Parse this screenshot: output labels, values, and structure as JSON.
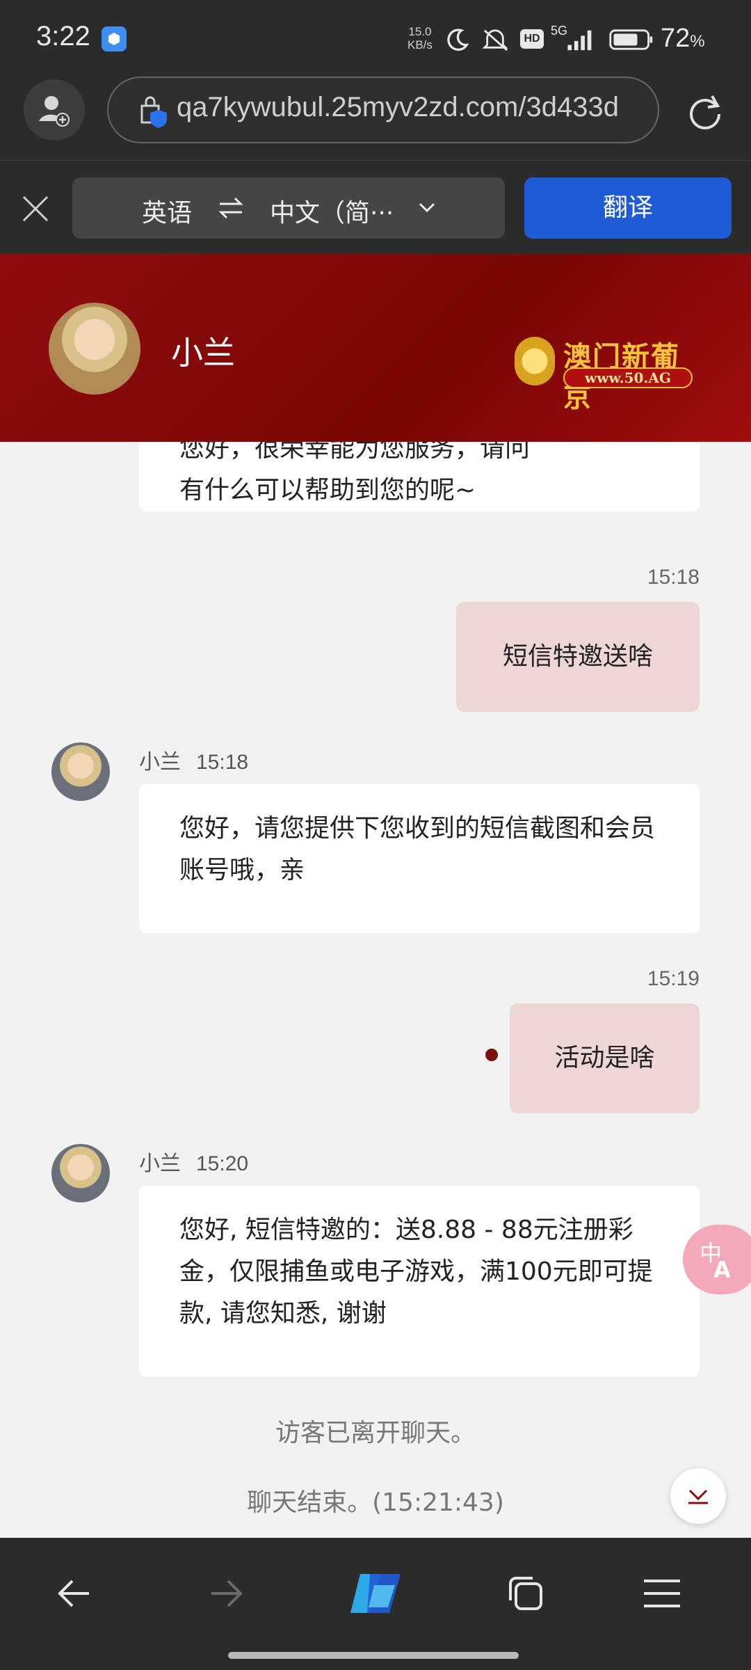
{
  "status_bar": {
    "time": "3:22",
    "network_speed_value": "15.0",
    "network_speed_unit": "KB/s",
    "signal_type": "5G",
    "hd_label": "HD",
    "battery_percent": "72",
    "battery_unit": "%"
  },
  "browser": {
    "url": "qa7kywubul.25myv2zd.com/3d433d"
  },
  "translate_bar": {
    "source_lang": "英语",
    "target_lang": "中文（简···",
    "translate_button": "翻译"
  },
  "chat_header": {
    "agent_name": "小兰",
    "brand_title": "澳门新葡京",
    "brand_url": "www.50.AG"
  },
  "messages": [
    {
      "direction": "in",
      "text_partial_top": "您好，很荣幸能为您服务，请问",
      "text": "有什么可以帮助到您的呢~"
    },
    {
      "direction": "out",
      "time": "15:18",
      "text": "短信特邀送啥"
    },
    {
      "direction": "in",
      "sender": "小兰",
      "time": "15:18",
      "text": "您好，请您提供下您收到的短信截图和会员账号哦，亲"
    },
    {
      "direction": "out",
      "time": "15:19",
      "text": "活动是啥"
    },
    {
      "direction": "in",
      "sender": "小兰",
      "time": "15:20",
      "text": "您好, 短信特邀的：送8.88 - 88元注册彩金，仅限捕鱼或电子游戏，满100元即可提款, 请您知悉, 谢谢"
    }
  ],
  "system_messages": {
    "visitor_left": "访客已离开聊天。",
    "chat_ended": "聊天结束。(15:21:43)"
  },
  "icons": {
    "profile": "add-profile-icon",
    "site_security": "site-security-icon",
    "reload": "reload-icon",
    "close": "close-icon",
    "swap": "swap-icon",
    "chevron": "chevron-down-icon",
    "translate_fab": "translate-icon",
    "scroll_down": "scroll-down-icon",
    "back": "back-arrow-icon",
    "forward": "forward-arrow-icon",
    "copilot": "copilot-icon",
    "tabs": "tabs-icon",
    "menu": "menu-icon"
  },
  "colors": {
    "header_red": "#8f0d0d",
    "outgoing_bubble": "#eed6d6",
    "translate_button": "#1f5bd6"
  }
}
